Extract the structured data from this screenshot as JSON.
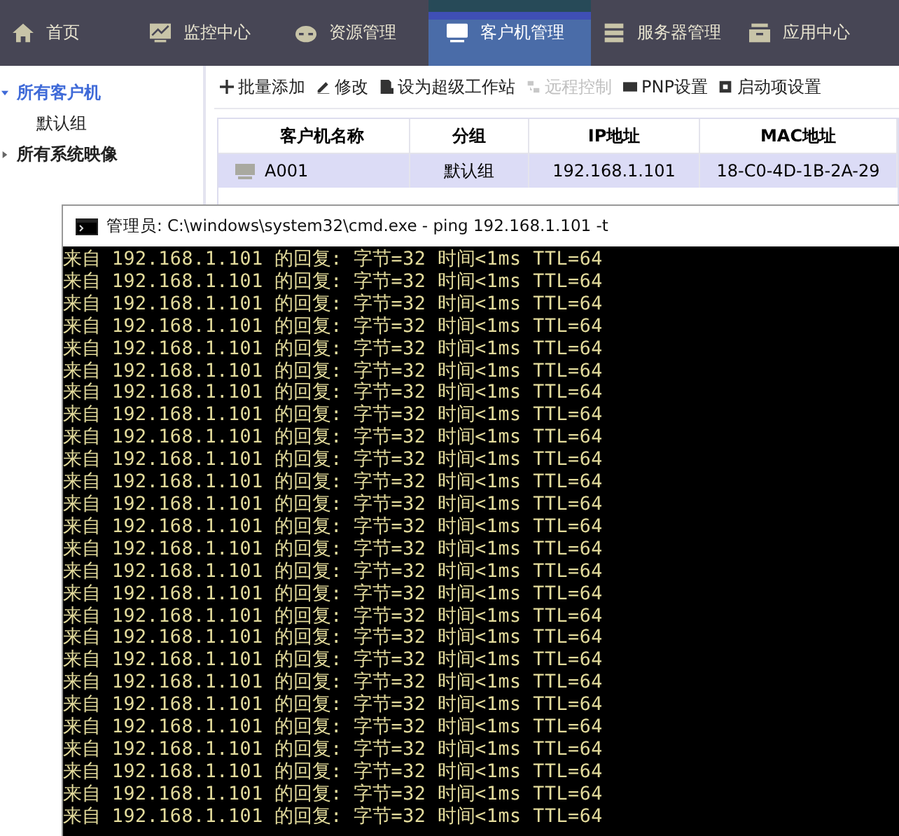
{
  "nav": [
    {
      "label": "首页",
      "selected": false
    },
    {
      "label": "监控中心",
      "selected": false
    },
    {
      "label": "资源管理",
      "selected": false
    },
    {
      "label": "客户机管理",
      "selected": true
    },
    {
      "label": "服务器管理",
      "selected": false
    },
    {
      "label": "应用中心",
      "selected": false
    }
  ],
  "sidebar": {
    "items": [
      {
        "label": "所有客户机",
        "selected": true,
        "expanded": true,
        "children": [
          {
            "label": "默认组"
          }
        ]
      },
      {
        "label": "所有系统映像",
        "selected": false,
        "expanded": false
      }
    ]
  },
  "toolbar": [
    {
      "label": "批量添加",
      "disabled": false
    },
    {
      "label": "修改",
      "disabled": false
    },
    {
      "label": "设为超级工作站",
      "disabled": false
    },
    {
      "label": "远程控制",
      "disabled": true
    },
    {
      "label": "PNP设置",
      "disabled": false
    },
    {
      "label": "启动项设置",
      "disabled": false
    }
  ],
  "table": {
    "columns": [
      "客户机名称",
      "分组",
      "IP地址",
      "MAC地址"
    ],
    "rows": [
      {
        "cells": [
          "A001",
          "默认组",
          "192.168.1.101",
          "18-C0-4D-1B-2A-29"
        ],
        "selected": true
      }
    ]
  },
  "console": {
    "title": "管理员: C:\\windows\\system32\\cmd.exe - ping  192.168.1.101 -t",
    "lines": [
      "来自 192.168.1.101 的回复: 字节=32 时间<1ms TTL=64",
      "来自 192.168.1.101 的回复: 字节=32 时间<1ms TTL=64",
      "来自 192.168.1.101 的回复: 字节=32 时间<1ms TTL=64",
      "来自 192.168.1.101 的回复: 字节=32 时间<1ms TTL=64",
      "来自 192.168.1.101 的回复: 字节=32 时间<1ms TTL=64",
      "来自 192.168.1.101 的回复: 字节=32 时间<1ms TTL=64",
      "来自 192.168.1.101 的回复: 字节=32 时间<1ms TTL=64",
      "来自 192.168.1.101 的回复: 字节=32 时间<1ms TTL=64",
      "来自 192.168.1.101 的回复: 字节=32 时间<1ms TTL=64",
      "来自 192.168.1.101 的回复: 字节=32 时间<1ms TTL=64",
      "来自 192.168.1.101 的回复: 字节=32 时间<1ms TTL=64",
      "来自 192.168.1.101 的回复: 字节=32 时间<1ms TTL=64",
      "来自 192.168.1.101 的回复: 字节=32 时间<1ms TTL=64",
      "来自 192.168.1.101 的回复: 字节=32 时间<1ms TTL=64",
      "来自 192.168.1.101 的回复: 字节=32 时间<1ms TTL=64",
      "来自 192.168.1.101 的回复: 字节=32 时间<1ms TTL=64",
      "来自 192.168.1.101 的回复: 字节=32 时间<1ms TTL=64",
      "来自 192.168.1.101 的回复: 字节=32 时间<1ms TTL=64",
      "来自 192.168.1.101 的回复: 字节=32 时间<1ms TTL=64",
      "来自 192.168.1.101 的回复: 字节=32 时间<1ms TTL=64",
      "来自 192.168.1.101 的回复: 字节=32 时间<1ms TTL=64",
      "来自 192.168.1.101 的回复: 字节=32 时间<1ms TTL=64",
      "来自 192.168.1.101 的回复: 字节=32 时间<1ms TTL=64",
      "来自 192.168.1.101 的回复: 字节=32 时间<1ms TTL=64",
      "来自 192.168.1.101 的回复: 字节=32 时间<1ms TTL=64",
      "来自 192.168.1.101 的回复: 字节=32 时间<1ms TTL=64"
    ]
  }
}
